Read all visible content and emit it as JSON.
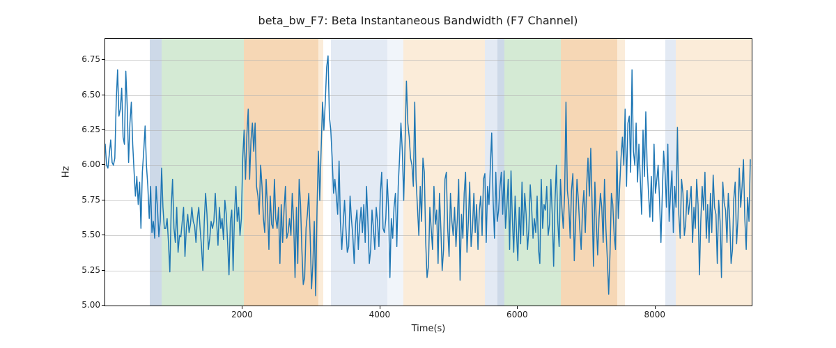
{
  "chart_data": {
    "type": "line",
    "title": "beta_bw_F7: Beta Instantaneous Bandwidth (F7 Channel)",
    "xlabel": "Time(s)",
    "ylabel": "Hz",
    "xlim": [
      0,
      9400
    ],
    "ylim": [
      5.0,
      6.9
    ],
    "xticks": [
      2000,
      4000,
      6000,
      8000
    ],
    "yticks": [
      5.0,
      5.25,
      5.5,
      5.75,
      6.0,
      6.25,
      6.5,
      6.75
    ],
    "ytick_labels": [
      "5.00",
      "5.25",
      "5.50",
      "5.75",
      "6.00",
      "6.25",
      "6.50",
      "6.75"
    ],
    "bands": [
      {
        "x0": 650,
        "x1": 820,
        "color": "#cdd9e8"
      },
      {
        "x0": 820,
        "x1": 2020,
        "color": "#d4ead4"
      },
      {
        "x0": 2020,
        "x1": 3100,
        "color": "#f6d7b5"
      },
      {
        "x0": 3100,
        "x1": 3170,
        "color": "#fbecd9"
      },
      {
        "x0": 3280,
        "x1": 4100,
        "color": "#e3eaf4"
      },
      {
        "x0": 4100,
        "x1": 4340,
        "color": "#f1f5fa"
      },
      {
        "x0": 4340,
        "x1": 5520,
        "color": "#fbecd9"
      },
      {
        "x0": 5520,
        "x1": 5700,
        "color": "#e3eaf4"
      },
      {
        "x0": 5700,
        "x1": 5800,
        "color": "#cdd9e8"
      },
      {
        "x0": 5800,
        "x1": 6620,
        "color": "#d4ead4"
      },
      {
        "x0": 6620,
        "x1": 7440,
        "color": "#f6d7b5"
      },
      {
        "x0": 7440,
        "x1": 7560,
        "color": "#fbecd9"
      },
      {
        "x0": 8140,
        "x1": 8300,
        "color": "#e3eaf4"
      },
      {
        "x0": 8300,
        "x1": 9400,
        "color": "#fbecd9"
      }
    ],
    "series": [
      {
        "name": "beta_bw_F7",
        "color": "#1f77b4",
        "x_step": 20,
        "values": [
          6.15,
          6.0,
          5.98,
          6.08,
          6.18,
          6.02,
          6.0,
          6.05,
          6.45,
          6.68,
          6.35,
          6.4,
          6.55,
          6.2,
          6.15,
          6.67,
          6.42,
          6.02,
          6.3,
          6.45,
          6.15,
          5.95,
          5.78,
          5.92,
          5.72,
          5.88,
          5.55,
          5.95,
          6.1,
          6.28,
          6.0,
          5.85,
          5.62,
          5.85,
          5.52,
          5.6,
          5.48,
          5.85,
          5.7,
          5.49,
          5.6,
          5.98,
          5.7,
          5.55,
          5.55,
          5.62,
          5.45,
          5.24,
          5.7,
          5.9,
          5.55,
          5.45,
          5.7,
          5.38,
          5.5,
          5.49,
          5.6,
          5.7,
          5.35,
          5.55,
          5.65,
          5.52,
          5.58,
          5.7,
          5.6,
          5.57,
          5.45,
          5.62,
          5.7,
          5.55,
          5.42,
          5.25,
          5.6,
          5.8,
          5.65,
          5.4,
          5.48,
          5.6,
          5.55,
          5.6,
          5.8,
          5.6,
          5.43,
          5.7,
          5.55,
          5.62,
          5.47,
          5.75,
          5.65,
          5.45,
          5.22,
          5.6,
          5.68,
          5.25,
          5.65,
          5.85,
          5.6,
          5.7,
          5.5,
          5.62,
          6.05,
          6.25,
          5.9,
          6.22,
          6.4,
          5.9,
          6.18,
          6.3,
          6.1,
          6.3,
          5.85,
          5.78,
          5.65,
          6.0,
          5.85,
          5.62,
          5.52,
          5.9,
          5.7,
          5.4,
          5.78,
          5.58,
          5.55,
          5.9,
          5.62,
          5.55,
          5.7,
          5.3,
          5.72,
          5.45,
          5.68,
          5.85,
          5.48,
          5.52,
          5.62,
          5.5,
          5.8,
          5.6,
          5.2,
          5.7,
          5.3,
          5.9,
          5.72,
          5.4,
          5.15,
          5.2,
          5.55,
          5.65,
          5.8,
          5.5,
          5.12,
          5.3,
          5.6,
          5.07,
          5.7,
          6.1,
          5.75,
          6.12,
          6.45,
          6.25,
          6.45,
          6.7,
          6.78,
          6.35,
          6.25,
          6.05,
          5.8,
          5.9,
          5.78,
          5.65,
          6.03,
          5.6,
          5.4,
          5.58,
          5.75,
          5.55,
          5.38,
          5.42,
          5.78,
          5.62,
          5.5,
          5.3,
          5.58,
          5.68,
          5.4,
          5.58,
          5.7,
          5.52,
          5.72,
          5.45,
          5.85,
          5.6,
          5.3,
          5.4,
          5.68,
          5.55,
          5.4,
          5.7,
          5.6,
          5.42,
          5.8,
          5.95,
          5.55,
          5.52,
          5.62,
          5.9,
          5.7,
          5.2,
          5.62,
          5.48,
          5.7,
          5.8,
          5.42,
          5.85,
          6.05,
          6.3,
          6.1,
          5.75,
          6.15,
          6.6,
          6.3,
          6.2,
          6.05,
          6.0,
          5.85,
          6.45,
          5.9,
          5.7,
          5.5,
          5.85,
          5.6,
          6.05,
          5.95,
          5.45,
          5.2,
          5.28,
          5.7,
          5.55,
          5.4,
          5.85,
          5.58,
          5.68,
          5.3,
          5.8,
          5.55,
          5.25,
          5.4,
          5.9,
          5.95,
          5.55,
          5.35,
          5.8,
          5.6,
          5.5,
          5.7,
          5.42,
          5.62,
          5.9,
          5.18,
          5.65,
          5.48,
          5.8,
          5.95,
          5.38,
          5.6,
          5.88,
          5.42,
          5.55,
          5.8,
          5.52,
          5.72,
          5.4,
          5.68,
          5.78,
          5.5,
          5.9,
          5.94,
          5.45,
          5.85,
          5.72,
          6.0,
          6.23,
          5.75,
          5.48,
          5.95,
          5.6,
          5.68,
          5.85,
          5.95,
          5.65,
          5.96,
          5.55,
          5.7,
          5.9,
          5.4,
          5.96,
          5.62,
          5.38,
          5.78,
          5.52,
          5.32,
          5.7,
          5.44,
          5.88,
          5.5,
          5.8,
          5.65,
          5.4,
          5.54,
          5.86,
          5.7,
          5.48,
          5.62,
          5.52,
          5.78,
          5.4,
          5.3,
          5.9,
          5.55,
          5.72,
          5.68,
          5.85,
          5.5,
          5.58,
          5.9,
          5.65,
          5.28,
          5.75,
          6.0,
          5.6,
          5.42,
          5.9,
          5.7,
          5.55,
          5.8,
          6.45,
          5.82,
          5.72,
          5.48,
          5.82,
          5.94,
          5.32,
          5.6,
          5.9,
          5.75,
          5.55,
          5.4,
          5.68,
          5.82,
          5.52,
          5.85,
          6.05,
          5.78,
          6.12,
          5.7,
          5.28,
          5.88,
          5.6,
          5.36,
          5.62,
          5.8,
          5.7,
          5.45,
          5.9,
          5.55,
          5.34,
          5.08,
          5.37,
          5.8,
          5.72,
          5.5,
          5.4,
          6.1,
          5.62,
          5.85,
          6.05,
          6.2,
          6.0,
          6.4,
          5.85,
          6.3,
          6.35,
          5.95,
          6.68,
          6.1,
          6.0,
          6.3,
          5.88,
          6.15,
          5.9,
          5.65,
          6.25,
          5.92,
          6.38,
          6.0,
          5.8,
          5.63,
          5.92,
          5.6,
          6.15,
          5.8,
          5.9,
          6.0,
          5.75,
          5.45,
          5.8,
          6.1,
          5.95,
          5.7,
          6.15,
          5.6,
          5.8,
          5.96,
          5.52,
          5.85,
          5.7,
          6.27,
          5.65,
          5.48,
          5.9,
          5.8,
          5.5,
          5.58,
          5.82,
          5.65,
          5.74,
          5.85,
          5.45,
          5.7,
          5.55,
          5.9,
          5.72,
          5.22,
          5.6,
          5.85,
          5.68,
          5.95,
          5.48,
          5.72,
          5.45,
          5.8,
          5.52,
          5.93,
          5.7,
          5.65,
          5.3,
          5.75,
          5.6,
          5.2,
          5.88,
          5.73,
          5.68,
          5.45,
          5.8,
          5.62,
          5.3,
          5.4,
          5.76,
          5.88,
          5.44,
          5.62,
          5.98,
          5.7,
          5.85,
          6.04,
          5.62,
          5.4,
          5.77,
          5.6,
          6.04
        ]
      }
    ]
  }
}
